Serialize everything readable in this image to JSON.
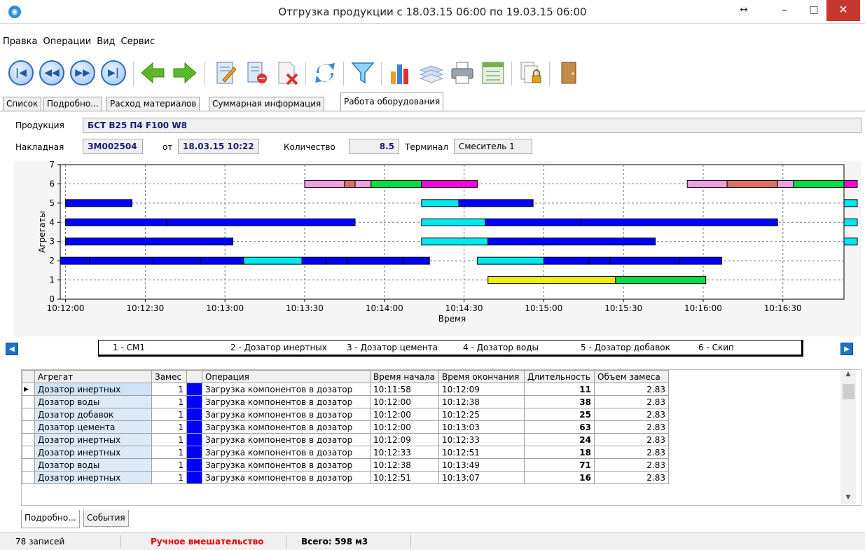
{
  "window": {
    "title": "Отгрузка продукции с 18.03.15 06:00 по 19.03.15 06:00",
    "app_icon": "app-logo-icon",
    "buttons": {
      "resize": "↔",
      "minimize": "–",
      "maximize": "□",
      "close": "✕"
    }
  },
  "menu": [
    "Правка",
    "Операции",
    "Вид",
    "Сервис"
  ],
  "toolbar": {
    "icons": [
      "first-record-icon",
      "prev-page-icon",
      "next-page-icon",
      "last-record-icon",
      "back-arrow-icon",
      "forward-arrow-icon",
      "edit-notebook-icon",
      "delete-document-icon",
      "cancel-document-icon",
      "refresh-icon",
      "filter-icon",
      "chart-icon",
      "layers-icon",
      "print-icon",
      "export-icon",
      "lock-copy-icon",
      "exit-door-icon"
    ],
    "glyphs": {
      "first": "|◀",
      "prev": "◀◀",
      "next": "▶▶",
      "last": "▶|"
    }
  },
  "tabs": [
    "Список",
    "Подробно...",
    "Расход материалов",
    "Суммарная информация",
    "Работа оборудования"
  ],
  "active_tab": 4,
  "info": {
    "product_label": "Продукция",
    "product_value": "БСТ В25 П4 F100 W8",
    "invoice_label": "Накладная",
    "invoice_value": "ЗМ002504",
    "from_label": "от",
    "date_value": "18.03.15 10:22",
    "qty_label": "Количество",
    "qty_value": "8.5",
    "terminal_label": "Терминал",
    "terminal_value": "Смеситель 1"
  },
  "chart_data": {
    "type": "gantt",
    "xlabel": "Время",
    "ylabel": "Агрегаты",
    "y_ticks": [
      "0",
      "1",
      "2",
      "3",
      "4",
      "5",
      "6",
      "7"
    ],
    "x_ticks": [
      "10:12:00",
      "10:12:30",
      "10:13:00",
      "10:13:30",
      "10:14:00",
      "10:14:30",
      "10:15:00",
      "10:15:30",
      "10:16:00",
      "10:16:30"
    ],
    "xlim": [
      "10:11:58",
      "10:16:53"
    ],
    "ylim": [
      0,
      7
    ],
    "grid": true,
    "bars": [
      {
        "y": 6,
        "start": "10:13:30",
        "end": "10:13:45",
        "color": "#f0a0e0"
      },
      {
        "y": 6,
        "start": "10:13:45",
        "end": "10:13:49",
        "color": "#e07060"
      },
      {
        "y": 6,
        "start": "10:13:49",
        "end": "10:13:55",
        "color": "#f0a0e0"
      },
      {
        "y": 6,
        "start": "10:13:55",
        "end": "10:14:14",
        "color": "#00e040"
      },
      {
        "y": 6,
        "start": "10:14:14",
        "end": "10:14:35",
        "color": "#ff00e0"
      },
      {
        "y": 6,
        "start": "10:15:54",
        "end": "10:16:09",
        "color": "#f0a0e0"
      },
      {
        "y": 6,
        "start": "10:16:09",
        "end": "10:16:28",
        "color": "#e07060"
      },
      {
        "y": 6,
        "start": "10:16:28",
        "end": "10:16:34",
        "color": "#f0a0e0"
      },
      {
        "y": 6,
        "start": "10:16:34",
        "end": "10:16:53",
        "color": "#00e040"
      },
      {
        "y": 6,
        "start": "10:16:53",
        "end": "10:16:58",
        "color": "#ff00e0"
      },
      {
        "y": 5,
        "start": "10:12:00",
        "end": "10:12:25",
        "color": "#0000ff"
      },
      {
        "y": 5,
        "start": "10:14:14",
        "end": "10:14:28",
        "color": "#00e8f0"
      },
      {
        "y": 5,
        "start": "10:14:28",
        "end": "10:14:56",
        "color": "#0000ff"
      },
      {
        "y": 5,
        "start": "10:16:53",
        "end": "10:16:58",
        "color": "#00e8f0"
      },
      {
        "y": 4,
        "start": "10:12:00",
        "end": "10:12:38",
        "color": "#0000ff"
      },
      {
        "y": 4,
        "start": "10:12:38",
        "end": "10:13:49",
        "color": "#0000ff"
      },
      {
        "y": 4,
        "start": "10:14:14",
        "end": "10:14:38",
        "color": "#00e8f0"
      },
      {
        "y": 4,
        "start": "10:14:38",
        "end": "10:15:14",
        "color": "#0000ff"
      },
      {
        "y": 4,
        "start": "10:15:14",
        "end": "10:16:28",
        "color": "#0000ff"
      },
      {
        "y": 4,
        "start": "10:16:53",
        "end": "10:16:58",
        "color": "#00e8f0"
      },
      {
        "y": 3,
        "start": "10:12:00",
        "end": "10:13:03",
        "color": "#0000ff"
      },
      {
        "y": 3,
        "start": "10:14:14",
        "end": "10:14:39",
        "color": "#00e8f0"
      },
      {
        "y": 3,
        "start": "10:14:39",
        "end": "10:15:42",
        "color": "#0000ff"
      },
      {
        "y": 3,
        "start": "10:16:53",
        "end": "10:16:58",
        "color": "#00e8f0"
      },
      {
        "y": 2,
        "start": "10:11:58",
        "end": "10:12:09",
        "color": "#0000ff"
      },
      {
        "y": 2,
        "start": "10:12:09",
        "end": "10:12:33",
        "color": "#0000ff"
      },
      {
        "y": 2,
        "start": "10:12:33",
        "end": "10:12:51",
        "color": "#0000ff"
      },
      {
        "y": 2,
        "start": "10:12:51",
        "end": "10:13:07",
        "color": "#0000ff"
      },
      {
        "y": 2,
        "start": "10:13:07",
        "end": "10:13:29",
        "color": "#00e8f0"
      },
      {
        "y": 2,
        "start": "10:13:29",
        "end": "10:13:38",
        "color": "#0000ff"
      },
      {
        "y": 2,
        "start": "10:13:38",
        "end": "10:13:46",
        "color": "#0000ff"
      },
      {
        "y": 2,
        "start": "10:13:46",
        "end": "10:14:07",
        "color": "#0000ff"
      },
      {
        "y": 2,
        "start": "10:14:07",
        "end": "10:14:17",
        "color": "#0000ff"
      },
      {
        "y": 2,
        "start": "10:14:35",
        "end": "10:15:00",
        "color": "#00e8f0"
      },
      {
        "y": 2,
        "start": "10:15:00",
        "end": "10:15:17",
        "color": "#0000ff"
      },
      {
        "y": 2,
        "start": "10:15:17",
        "end": "10:15:25",
        "color": "#0000ff"
      },
      {
        "y": 2,
        "start": "10:15:25",
        "end": "10:15:51",
        "color": "#0000ff"
      },
      {
        "y": 2,
        "start": "10:15:51",
        "end": "10:16:07",
        "color": "#0000ff"
      },
      {
        "y": 1,
        "start": "10:14:39",
        "end": "10:15:27",
        "color": "#f0f000"
      },
      {
        "y": 1,
        "start": "10:15:27",
        "end": "10:16:01",
        "color": "#00e040"
      }
    ]
  },
  "legend": [
    "1 - СМ1",
    "2 - Дозатор инертных",
    "3 - Дозатор цемента",
    "4 - Дозатор воды",
    "5 - Дозатор добавок",
    "6 - Скип"
  ],
  "legend_nav": {
    "left": "◀",
    "right": "▶"
  },
  "grid": {
    "columns": [
      "Агрегат",
      "Замес",
      "",
      "Операция",
      "Время начала",
      "Время окончания",
      "Длительность",
      "Объем замеса"
    ],
    "rows": [
      [
        "Дозатор инертных",
        "1",
        "",
        "Загрузка компонентов в дозатор",
        "10:11:58",
        "10:12:09",
        "11",
        "2.83"
      ],
      [
        "Дозатор воды",
        "1",
        "",
        "Загрузка компонентов в дозатор",
        "10:12:00",
        "10:12:38",
        "38",
        "2.83"
      ],
      [
        "Дозатор добавок",
        "1",
        "",
        "Загрузка компонентов в дозатор",
        "10:12:00",
        "10:12:25",
        "25",
        "2.83"
      ],
      [
        "Дозатор цемента",
        "1",
        "",
        "Загрузка компонентов в дозатор",
        "10:12:00",
        "10:13:03",
        "63",
        "2.83"
      ],
      [
        "Дозатор инертных",
        "1",
        "",
        "Загрузка компонентов в дозатор",
        "10:12:09",
        "10:12:33",
        "24",
        "2.83"
      ],
      [
        "Дозатор инертных",
        "1",
        "",
        "Загрузка компонентов в дозатор",
        "10:12:33",
        "10:12:51",
        "18",
        "2.83"
      ],
      [
        "Дозатор воды",
        "1",
        "",
        "Загрузка компонентов в дозатор",
        "10:12:38",
        "10:13:49",
        "71",
        "2.83"
      ],
      [
        "Дозатор инертных",
        "1",
        "",
        "Загрузка компонентов в дозатор",
        "10:12:51",
        "10:13:07",
        "16",
        "2.83"
      ]
    ],
    "selected_row": 0,
    "row_indicator": "▶",
    "scroll_up": "▲",
    "scroll_down": "▼"
  },
  "bottom_tabs": [
    "Подробно...",
    "События"
  ],
  "status": {
    "records": "78 записей",
    "manual": "Ручное вмешательство",
    "total": "Всего: 598 м3",
    "manual_color": "#e00000"
  }
}
